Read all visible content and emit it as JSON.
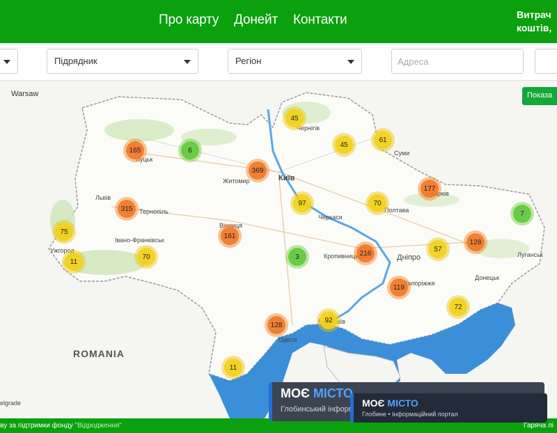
{
  "nav": {
    "about": "Про карту",
    "donate": "Донейт",
    "contacts": "Контакти",
    "right_line1": "Витрач",
    "right_line2": "коштів,"
  },
  "filters": {
    "contractor": "Підрядник",
    "region": "Регіон",
    "address_placeholder": "Адреса"
  },
  "map": {
    "show_button": "Показа",
    "labels": {
      "warsaw": "Warsaw",
      "romania": "ROMANIA",
      "belgrade": "elgrade",
      "kyiv": "Київ",
      "lutsk": "Луцьк",
      "zhytomyr": "Житомир",
      "chernihiv": "Чернігів",
      "sumy": "Суми",
      "lviv": "Львів",
      "ternopil": "Тернопіль",
      "ivano": "Івано-Франківськ",
      "uzhhorod": "Ужгород",
      "vinnytsia": "Вінниця",
      "cherkasy": "Черкаси",
      "poltava": "Полтава",
      "kharkiv": "Харків",
      "kropyvnytskyi": "Кропивницький",
      "dnipro": "Дніпро",
      "zaporizhzhia": "Запоріжжя",
      "donetsk": "Донецьк",
      "luhansk": "Луганськ",
      "odesa": "Одеса",
      "mykolaiv": "Миколаїв"
    },
    "clusters": [
      {
        "count": "165",
        "level": "orange"
      },
      {
        "count": "6",
        "level": "green"
      },
      {
        "count": "369",
        "level": "orange"
      },
      {
        "count": "45",
        "level": "yellow"
      },
      {
        "count": "45",
        "level": "yellow"
      },
      {
        "count": "61",
        "level": "yellow"
      },
      {
        "count": "315",
        "level": "orange"
      },
      {
        "count": "97",
        "level": "yellow"
      },
      {
        "count": "70",
        "level": "yellow"
      },
      {
        "count": "177",
        "level": "orange"
      },
      {
        "count": "7",
        "level": "green"
      },
      {
        "count": "75",
        "level": "yellow"
      },
      {
        "count": "11",
        "level": "yellow"
      },
      {
        "count": "70",
        "level": "yellow"
      },
      {
        "count": "161",
        "level": "orange"
      },
      {
        "count": "3",
        "level": "green"
      },
      {
        "count": "216",
        "level": "orange"
      },
      {
        "count": "57",
        "level": "yellow"
      },
      {
        "count": "128",
        "level": "orange"
      },
      {
        "count": "119",
        "level": "orange"
      },
      {
        "count": "72",
        "level": "yellow"
      },
      {
        "count": "128",
        "level": "orange"
      },
      {
        "count": "92",
        "level": "yellow"
      },
      {
        "count": "11",
        "level": "yellow"
      }
    ]
  },
  "footer": {
    "left": "ву за підтримки фонду",
    "left_fund": "\"Відродження\"",
    "right": "Гаряча лі"
  },
  "banner1": {
    "brand_a": "МОЄ ",
    "brand_b": "МІСТО",
    "subtitle": "Глобинський інформ"
  },
  "banner2": {
    "brand_a": "МОЄ ",
    "brand_b": "МІСТО",
    "subtitle": "Глобине • Інформаційний портал"
  },
  "colors": {
    "header": "#0aa00e",
    "sea": "#3b8fd9",
    "cluster_orange": "#f07323",
    "cluster_yellow": "#f1d31a",
    "cluster_green": "#60c83c",
    "banner_accent": "#4ea3ff"
  }
}
